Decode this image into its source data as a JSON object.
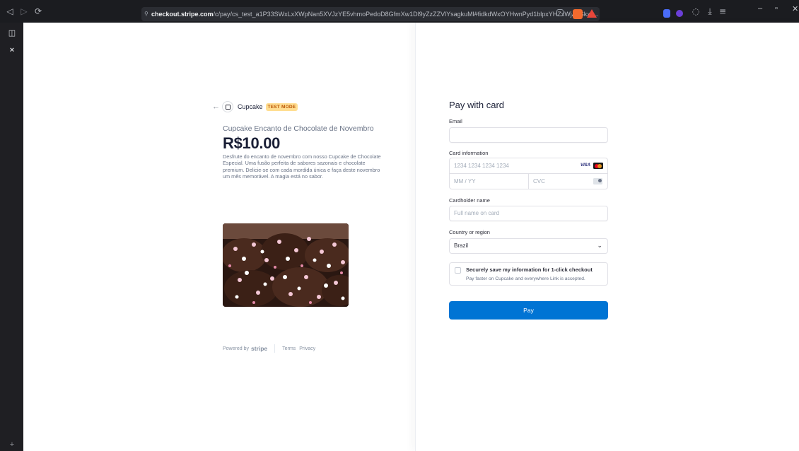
{
  "browser": {
    "url_domain": "checkout.stripe.com",
    "url_path": "/c/pay/cs_test_a1P33SWxLxXWpNan5XVJzYE5vhmoPedoD8GfmXw1Dl9yZzZZVlYsagkuMl#fidkdWxOYHwnPyd1blpxYHZxWjA0Skxk...",
    "nav_back": "◁",
    "nav_forward": "▷",
    "reload": "⟳",
    "minimize": "–",
    "maximize": "▫",
    "close": "✕"
  },
  "sidebar": {
    "panel_icon": "◫",
    "close_icon": "×",
    "add_icon": "+"
  },
  "merchant": {
    "back": "←",
    "name": "Cupcake",
    "badge": "TEST MODE"
  },
  "product": {
    "name": "Cupcake Encanto de Chocolate de Novembro",
    "price": "R$10.00",
    "description": "Desfrute do encanto de novembro com nosso Cupcake de Chocolate Especial. Uma fusão perfeita de sabores sazonais e chocolate premium. Delicie-se com cada mordida única e faça deste novembro um mês memorável. A magia está no sabor."
  },
  "footer": {
    "powered_by": "Powered by",
    "brand": "stripe",
    "terms": "Terms",
    "privacy": "Privacy"
  },
  "form": {
    "title": "Pay with card",
    "email_label": "Email",
    "email_value": "",
    "card_label": "Card information",
    "card_number_placeholder": "1234 1234 1234 1234",
    "card_exp_placeholder": "MM / YY",
    "card_cvc_placeholder": "CVC",
    "card_brand_visa": "VISA",
    "name_label": "Cardholder name",
    "name_placeholder": "Full name on card",
    "country_label": "Country or region",
    "country_value": "Brazil",
    "link_title": "Securely save my information for 1-click checkout",
    "link_sub": "Pay faster on Cupcake and everywhere Link is accepted.",
    "pay_label": "Pay"
  },
  "colors": {
    "accent": "#0074d4",
    "badge_bg": "#ffde92",
    "badge_text": "#bb5504"
  }
}
